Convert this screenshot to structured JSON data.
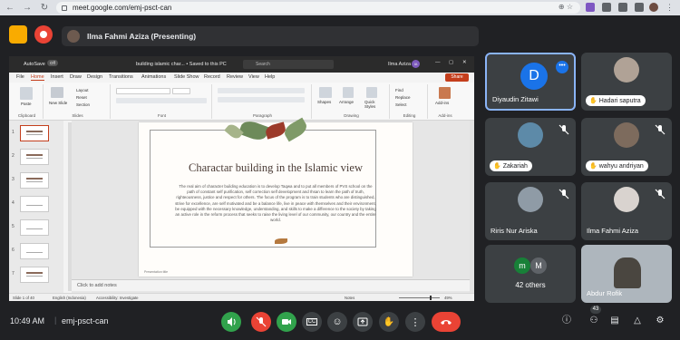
{
  "browser": {
    "url": "meet.google.com/emj-psct-can"
  },
  "meeting": {
    "presenter_label": "Ilma Fahmi Aziza (Presenting)",
    "time": "10:49 AM",
    "separator": "|",
    "code": "emj-psct-can",
    "people_count": "43"
  },
  "powerpoint": {
    "autosave": "AutoSave",
    "toggle": "Off",
    "filename": "building islamic char... • Saved to this PC",
    "search_placeholder": "Search",
    "user": "Ilma Aziza",
    "user_initials": "IA",
    "share_label": "Share",
    "tabs": [
      "File",
      "Home",
      "Insert",
      "Draw",
      "Design",
      "Transitions",
      "Animations",
      "Slide Show",
      "Record",
      "Review",
      "View",
      "Help"
    ],
    "groups": [
      "Clipboard",
      "Slides",
      "Font",
      "Paragraph",
      "Drawing",
      "Editing",
      "Add-ins"
    ],
    "ribbon_items": {
      "paste": "Paste",
      "new_slide": "New Slide",
      "layout": "Layout",
      "reset": "Reset",
      "section": "Section",
      "shapes": "Shapes",
      "arrange": "Arrange",
      "quick_styles": "Quick Styles",
      "find": "Find",
      "replace": "Replace",
      "select": "Select",
      "add_ins": "Add-ins"
    },
    "slide_numbers": [
      "1",
      "2",
      "3",
      "4",
      "5",
      "6",
      "7"
    ],
    "slide": {
      "title": "Charactar building in the Islamic view",
      "body": "The real aim of character building education is to develop Taqwa and to put all members of PVS school on the path of constant self purification, self correction self development and Ihsan to learn the path of truth, righteousness, justice and respect for others. The focus of the program is to train students who are distinguished, strive for excellence, are self motivated and be a balance life, live in peace with themselves and their environment, be equipped with the necessary knowledge, understanding, and skills to make a difference to the society by taking an active role in the reform process that seeks to raise the living level of our community, our country and the entire world.",
      "footer": "Presentation title"
    },
    "notes_placeholder": "Click to add notes",
    "status": {
      "slide_count": "Slide 1 of 40",
      "language": "English (Indonesia)",
      "accessibility": "Accessibility: Investigate",
      "notes": "Notes",
      "zoom": "49%"
    }
  },
  "participants": [
    {
      "name": "Diyaudin Zitawi",
      "initial": "D",
      "active": true
    },
    {
      "name": "Hadari saputra"
    },
    {
      "name": "Zakariah"
    },
    {
      "name": "wahyu andriyan"
    },
    {
      "name": "Riris Nur Ariska"
    },
    {
      "name": "Ilma Fahmi Aziza"
    },
    {
      "name": "42 others",
      "initials": [
        "m",
        "M"
      ]
    },
    {
      "name": "Abdur Rofik"
    }
  ],
  "colors": {
    "meet_bg": "#202124",
    "tile_bg": "#3c4043",
    "active_tile_border": "#8ab4f8",
    "hangup": "#ea4335",
    "mic_on_green": "#31a24c",
    "pp_accent": "#c43e1c"
  },
  "icons": {
    "controls": [
      "volume-icon",
      "mic-off-icon",
      "camera-icon",
      "captions-icon",
      "emoji-icon",
      "present-icon",
      "raise-hand-icon",
      "more-icon",
      "hang-up-icon"
    ],
    "right": [
      "info-icon",
      "people-icon",
      "chat-icon",
      "activities-icon",
      "host-controls-icon"
    ]
  }
}
